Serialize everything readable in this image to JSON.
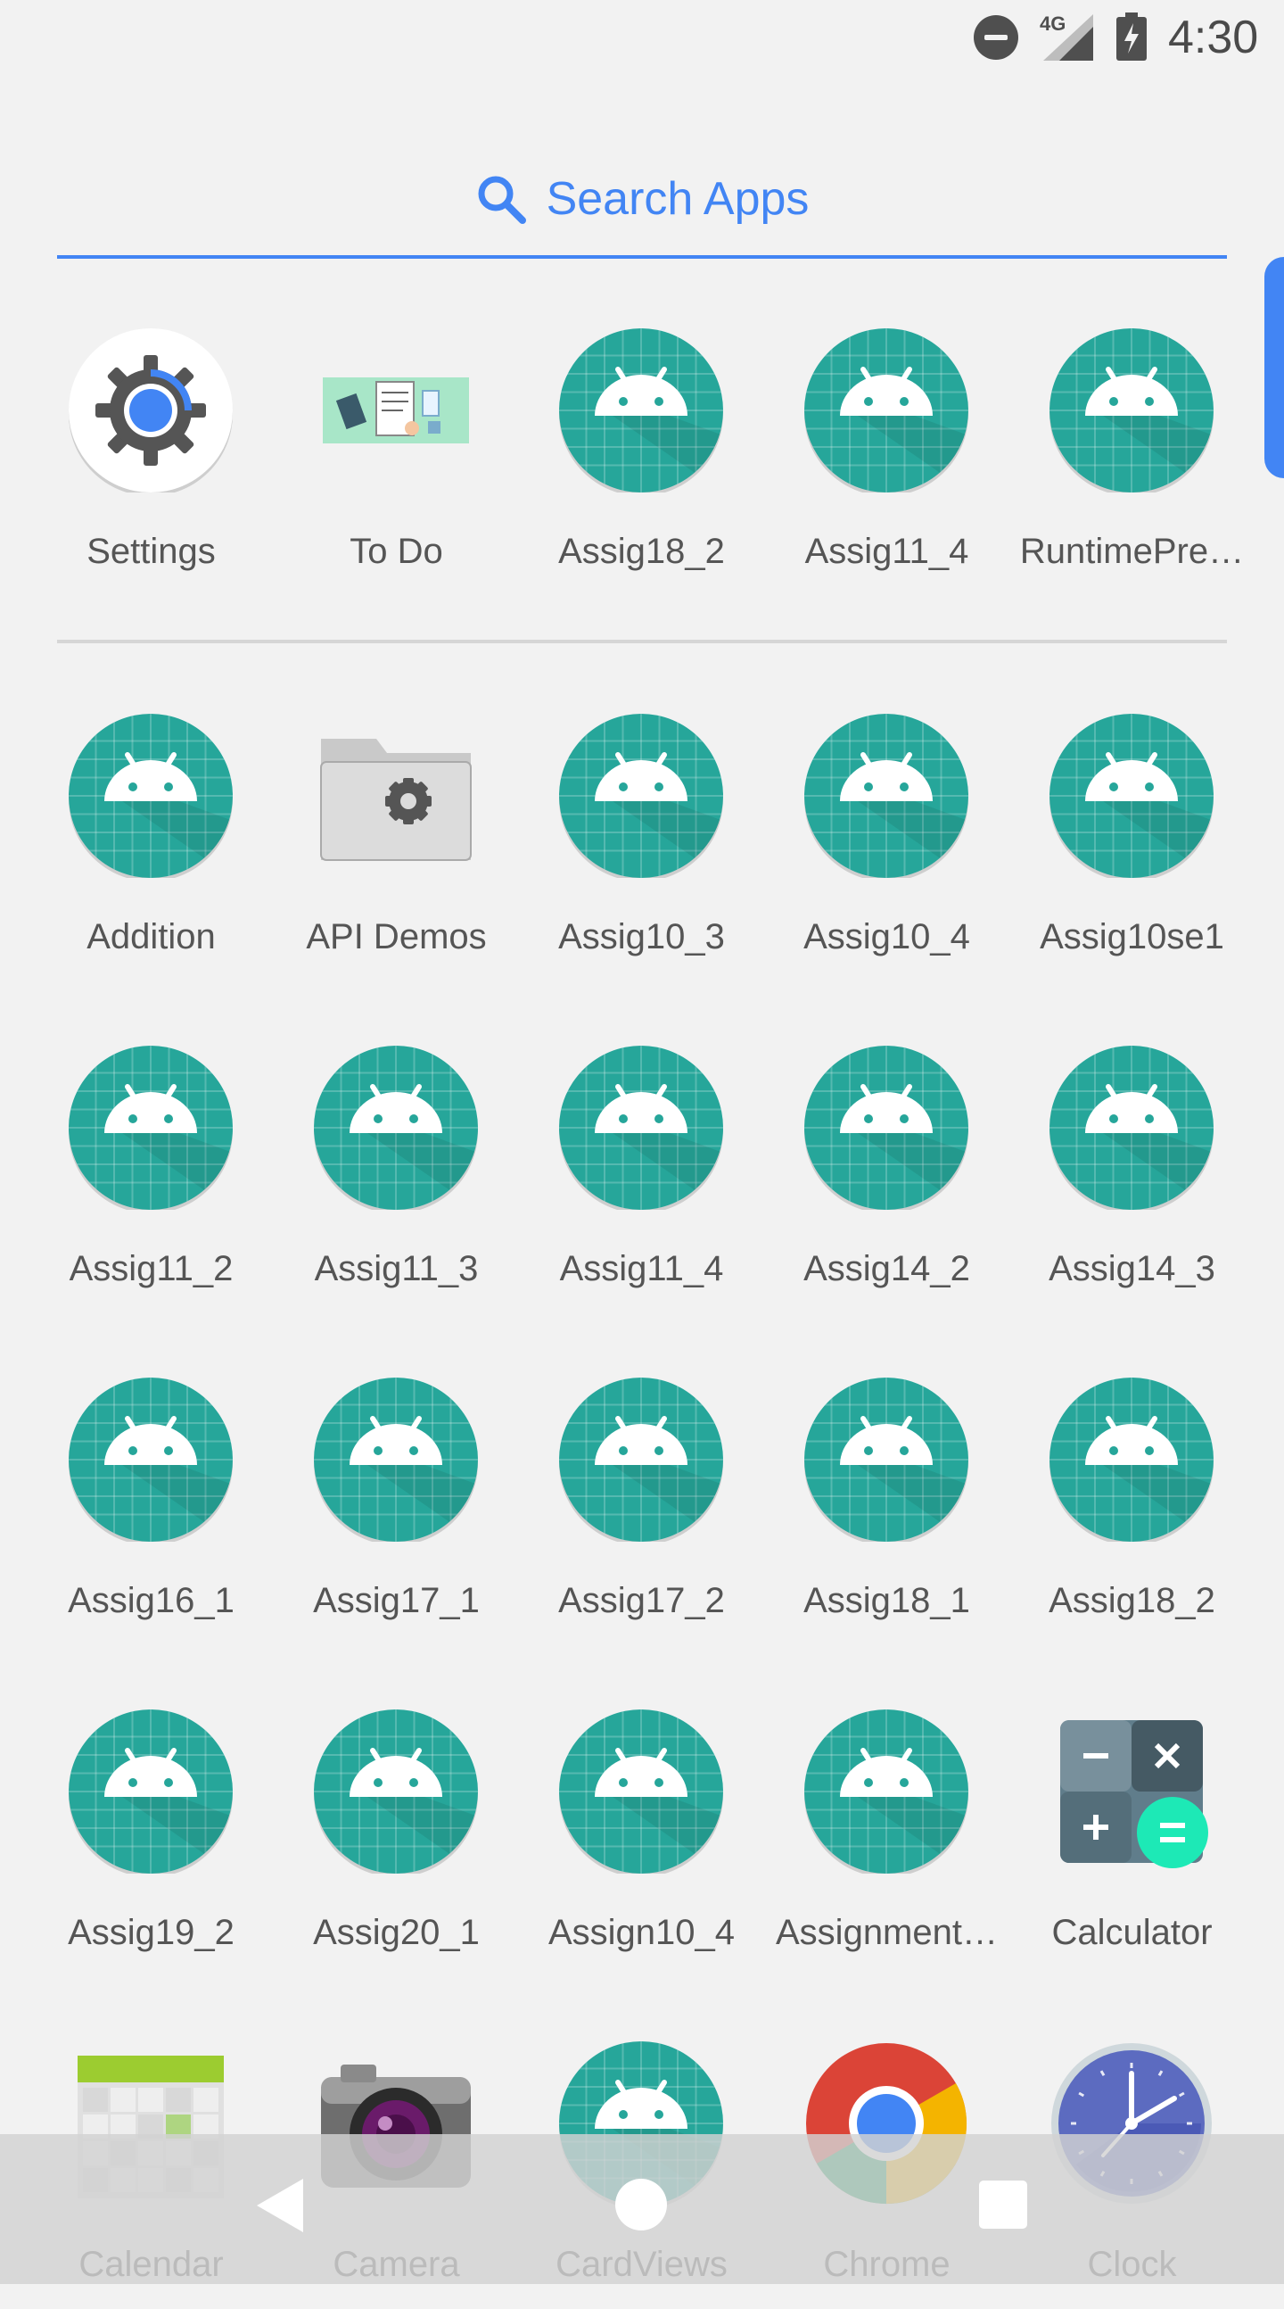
{
  "status_bar": {
    "network": "4G",
    "time": "4:30"
  },
  "search": {
    "label": "Search Apps"
  },
  "predicted_apps": [
    {
      "label": "Settings",
      "icon": "settings-icon"
    },
    {
      "label": "To Do",
      "icon": "todo-image-icon"
    },
    {
      "label": "Assig18_2",
      "icon": "android-icon"
    },
    {
      "label": "Assig11_4",
      "icon": "android-icon"
    },
    {
      "label": "RuntimePre…",
      "icon": "android-icon"
    }
  ],
  "apps": [
    {
      "label": "Addition",
      "icon": "android-icon"
    },
    {
      "label": "API Demos",
      "icon": "folder-gear-icon"
    },
    {
      "label": "Assig10_3",
      "icon": "android-icon"
    },
    {
      "label": "Assig10_4",
      "icon": "android-icon"
    },
    {
      "label": "Assig10se1",
      "icon": "android-icon"
    },
    {
      "label": "Assig11_2",
      "icon": "android-icon"
    },
    {
      "label": "Assig11_3",
      "icon": "android-icon"
    },
    {
      "label": "Assig11_4",
      "icon": "android-icon"
    },
    {
      "label": "Assig14_2",
      "icon": "android-icon"
    },
    {
      "label": "Assig14_3",
      "icon": "android-icon"
    },
    {
      "label": "Assig16_1",
      "icon": "android-icon"
    },
    {
      "label": "Assig17_1",
      "icon": "android-icon"
    },
    {
      "label": "Assig17_2",
      "icon": "android-icon"
    },
    {
      "label": "Assig18_1",
      "icon": "android-icon"
    },
    {
      "label": "Assig18_2",
      "icon": "android-icon"
    },
    {
      "label": "Assig19_2",
      "icon": "android-icon"
    },
    {
      "label": "Assig20_1",
      "icon": "android-icon"
    },
    {
      "label": "Assign10_4",
      "icon": "android-icon"
    },
    {
      "label": "Assignment…",
      "icon": "android-icon"
    },
    {
      "label": "Calculator",
      "icon": "calculator-icon"
    },
    {
      "label": "Calendar",
      "icon": "calendar-icon"
    },
    {
      "label": "Camera",
      "icon": "camera-icon"
    },
    {
      "label": "CardViews",
      "icon": "android-icon"
    },
    {
      "label": "Chrome",
      "icon": "chrome-icon"
    },
    {
      "label": "Clock",
      "icon": "clock-icon"
    }
  ],
  "colors": {
    "accent": "#4285f4",
    "android_icon_bg": "#26a69a",
    "label_text": "#555555",
    "background": "#f2f2f2"
  }
}
